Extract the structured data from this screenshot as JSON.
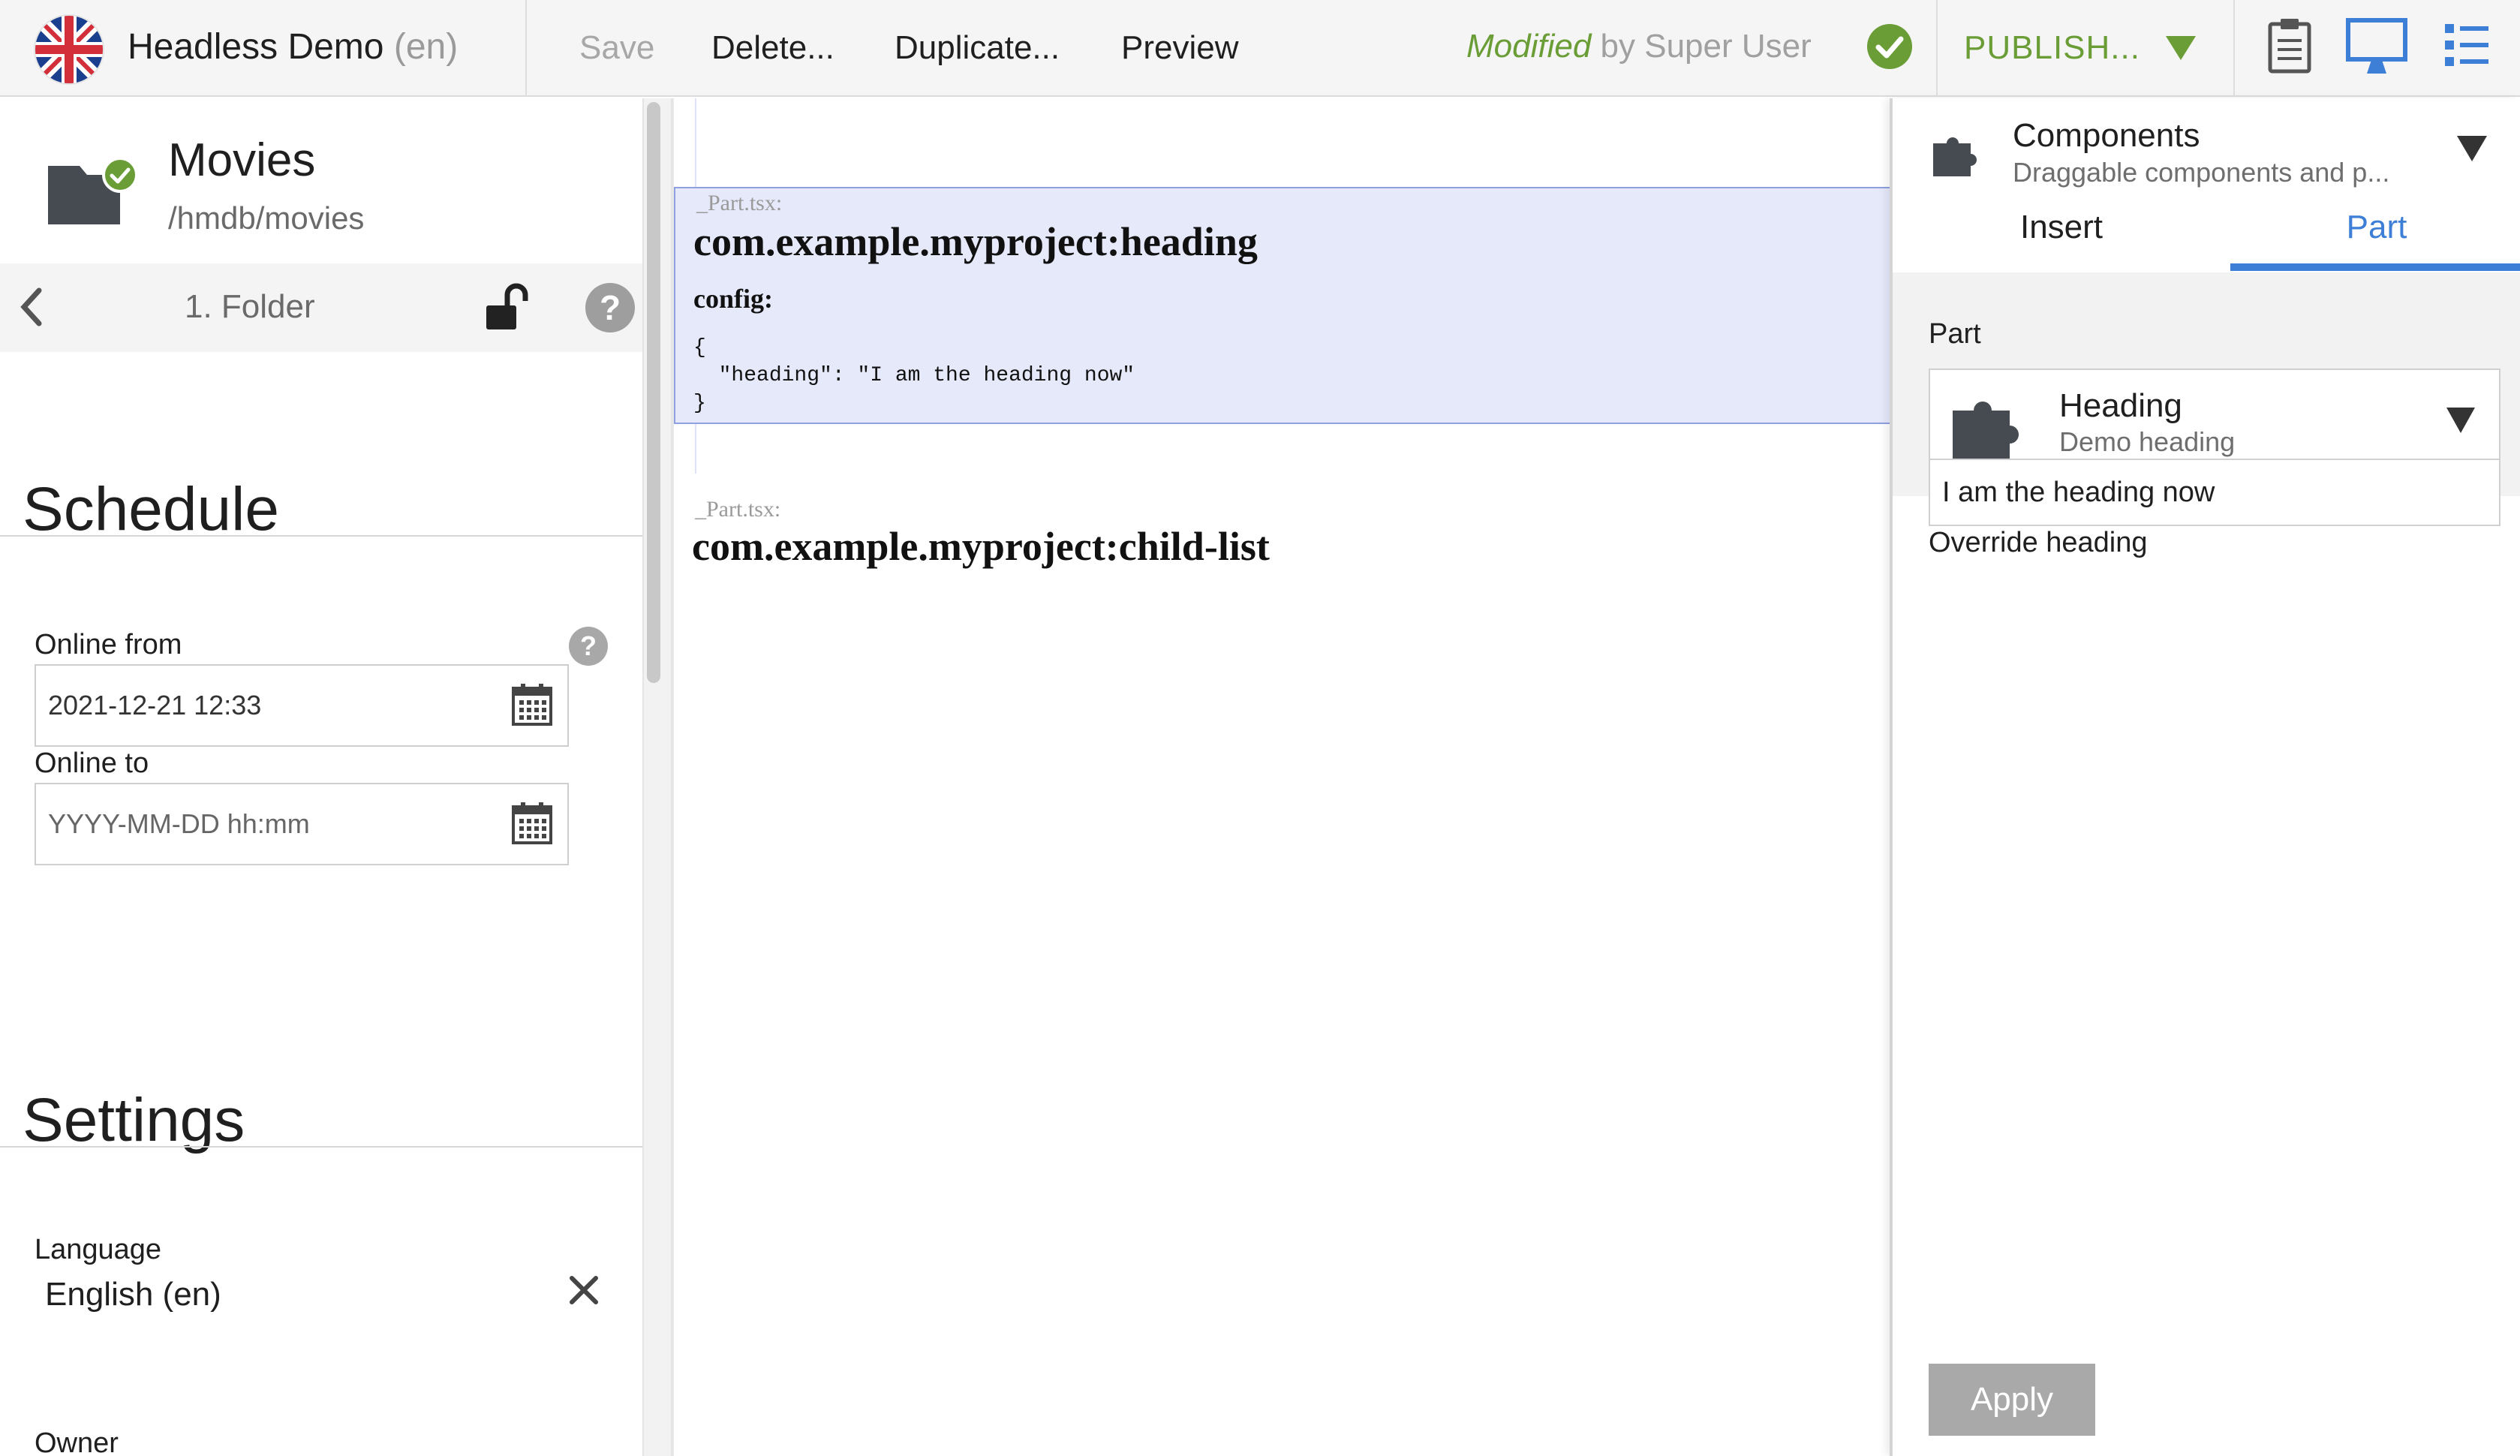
{
  "toolbar": {
    "title": "Headless Demo",
    "language": "(en)",
    "save": "Save",
    "delete": "Delete...",
    "duplicate": "Duplicate...",
    "preview": "Preview",
    "status_modified": "Modified",
    "status_by": " by Super User",
    "publish": "PUBLISH...",
    "accent_green": "#6a9d35",
    "accent_blue": "#3d7fd6"
  },
  "content": {
    "name": "Movies",
    "path": "/hmdb/movies"
  },
  "stepbar": {
    "step": "1. Folder"
  },
  "schedule": {
    "title": "Schedule",
    "online_from_label": "Online from",
    "online_from_value": "2021-12-21 12:33",
    "online_to_label": "Online to",
    "online_to_placeholder": "YYYY-MM-DD hh:mm"
  },
  "settings": {
    "title": "Settings",
    "language_label": "Language",
    "language_value": "English (en)",
    "owner_label": "Owner"
  },
  "preview": {
    "parts": [
      {
        "file": "_Part.tsx:",
        "name": "com.example.myproject:heading",
        "config_label": "config:",
        "config_json": "{\n  \"heading\": \"I am the heading now\"\n}"
      },
      {
        "file": "_Part.tsx:",
        "name": "com.example.myproject:child-list"
      }
    ]
  },
  "components": {
    "title": "Components",
    "subtitle": "Draggable components and p...",
    "tabs": [
      "Insert",
      "Part"
    ],
    "part_label": "Part",
    "part_name": "Heading",
    "part_desc": "Demo heading",
    "override_label": "Override heading",
    "override_value": "I am the heading now",
    "apply": "Apply"
  },
  "help_glyph": "?"
}
